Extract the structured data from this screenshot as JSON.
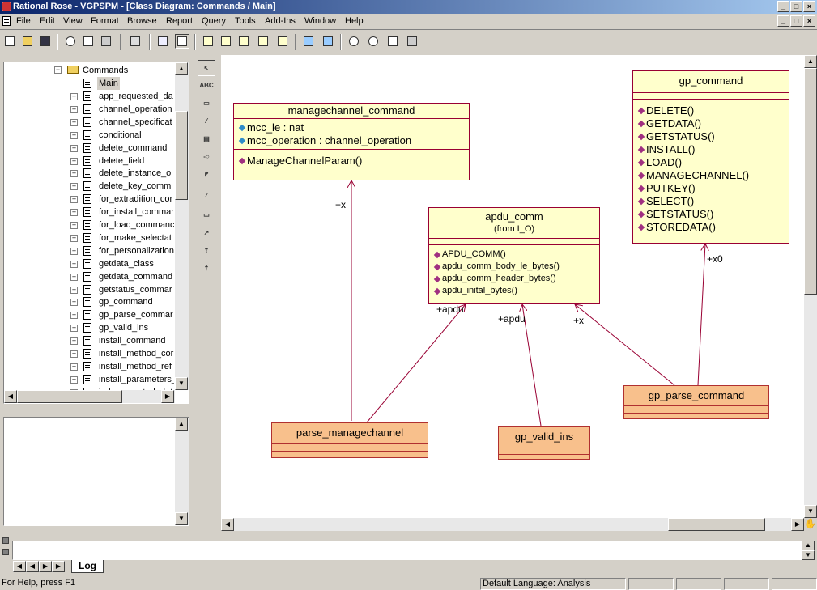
{
  "window": {
    "title": "Rational Rose - VGPSPM - [Class Diagram: Commands / Main]"
  },
  "menu": [
    "File",
    "Edit",
    "View",
    "Format",
    "Browse",
    "Report",
    "Query",
    "Tools",
    "Add-Ins",
    "Window",
    "Help"
  ],
  "browser": {
    "folder": "Commands",
    "diagram": "Main",
    "items": [
      "app_requested_da",
      "channel_operation",
      "channel_specificat",
      "conditional",
      "delete_command",
      "delete_field",
      "delete_instance_o",
      "delete_key_comm",
      "for_extradition_cor",
      "for_install_commar",
      "for_load_commanc",
      "for_make_selectat",
      "for_personalization",
      "getdata_class",
      "getdata_command",
      "getstatus_commar",
      "gp_command",
      "gp_parse_commar",
      "gp_valid_ins",
      "install_command",
      "install_method_cor",
      "install_method_ref",
      "install_parameters_",
      "iad_requested_dat"
    ]
  },
  "diagram": {
    "managechannel": {
      "name": "managechannel_command",
      "attributes": [
        "mcc_le : nat",
        "mcc_operation : channel_operation"
      ],
      "operations": [
        "ManageChannelParam()"
      ]
    },
    "apdu": {
      "name": "apdu_comm",
      "from": "(from I_O)",
      "operations": [
        "APDU_COMM()",
        "apdu_comm_body_le_bytes()",
        "apdu_comm_header_bytes()",
        "apdu_inital_bytes()"
      ]
    },
    "gp_command": {
      "name": "gp_command",
      "operations": [
        "DELETE()",
        "GETDATA()",
        "GETSTATUS()",
        "INSTALL()",
        "LOAD()",
        "MANAGECHANNEL()",
        "PUTKEY()",
        "SELECT()",
        "SETSTATUS()",
        "STOREDATA()"
      ]
    },
    "parse_managechannel": {
      "name": "parse_managechannel"
    },
    "gp_valid_ins": {
      "name": "gp_valid_ins"
    },
    "gp_parse_command": {
      "name": "gp_parse_command"
    },
    "roles": {
      "x1": "+x",
      "apdu1": "+apdu",
      "apdu2": "+apdu",
      "x2": "+x",
      "x0": "+x0"
    }
  },
  "log": {
    "tab": "Log"
  },
  "status": {
    "help": "For Help, press F1",
    "language": "Default Language: Analysis"
  },
  "colors": {
    "class_fill": "#ffffcc",
    "class_border": "#990033",
    "sub_fill": "#f8c08c"
  }
}
